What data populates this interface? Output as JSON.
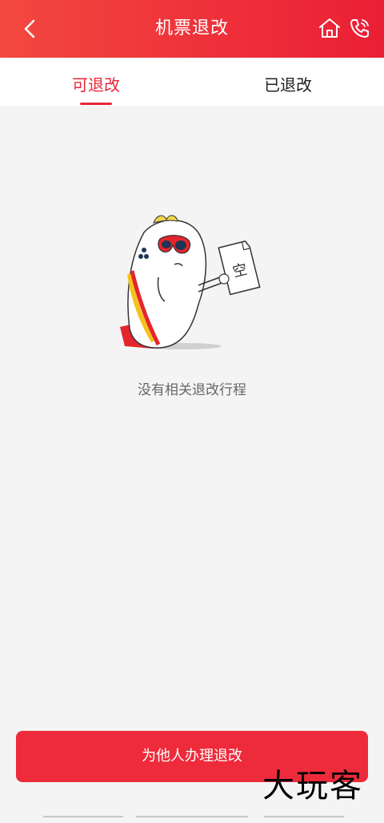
{
  "header": {
    "title": "机票退改",
    "icons": {
      "back": "chevron-left-icon",
      "home": "home-icon",
      "phone": "phone-icon"
    }
  },
  "tabs": [
    {
      "label": "可退改",
      "active": true
    },
    {
      "label": "已退改",
      "active": false
    }
  ],
  "empty_state": {
    "illustration_text": "空",
    "message": "没有相关退改行程"
  },
  "action": {
    "label": "为他人办理退改"
  },
  "watermark": "大玩客",
  "colors": {
    "brand": "#ee2b3b",
    "background": "#f4f4f4",
    "text_muted": "#666666"
  }
}
